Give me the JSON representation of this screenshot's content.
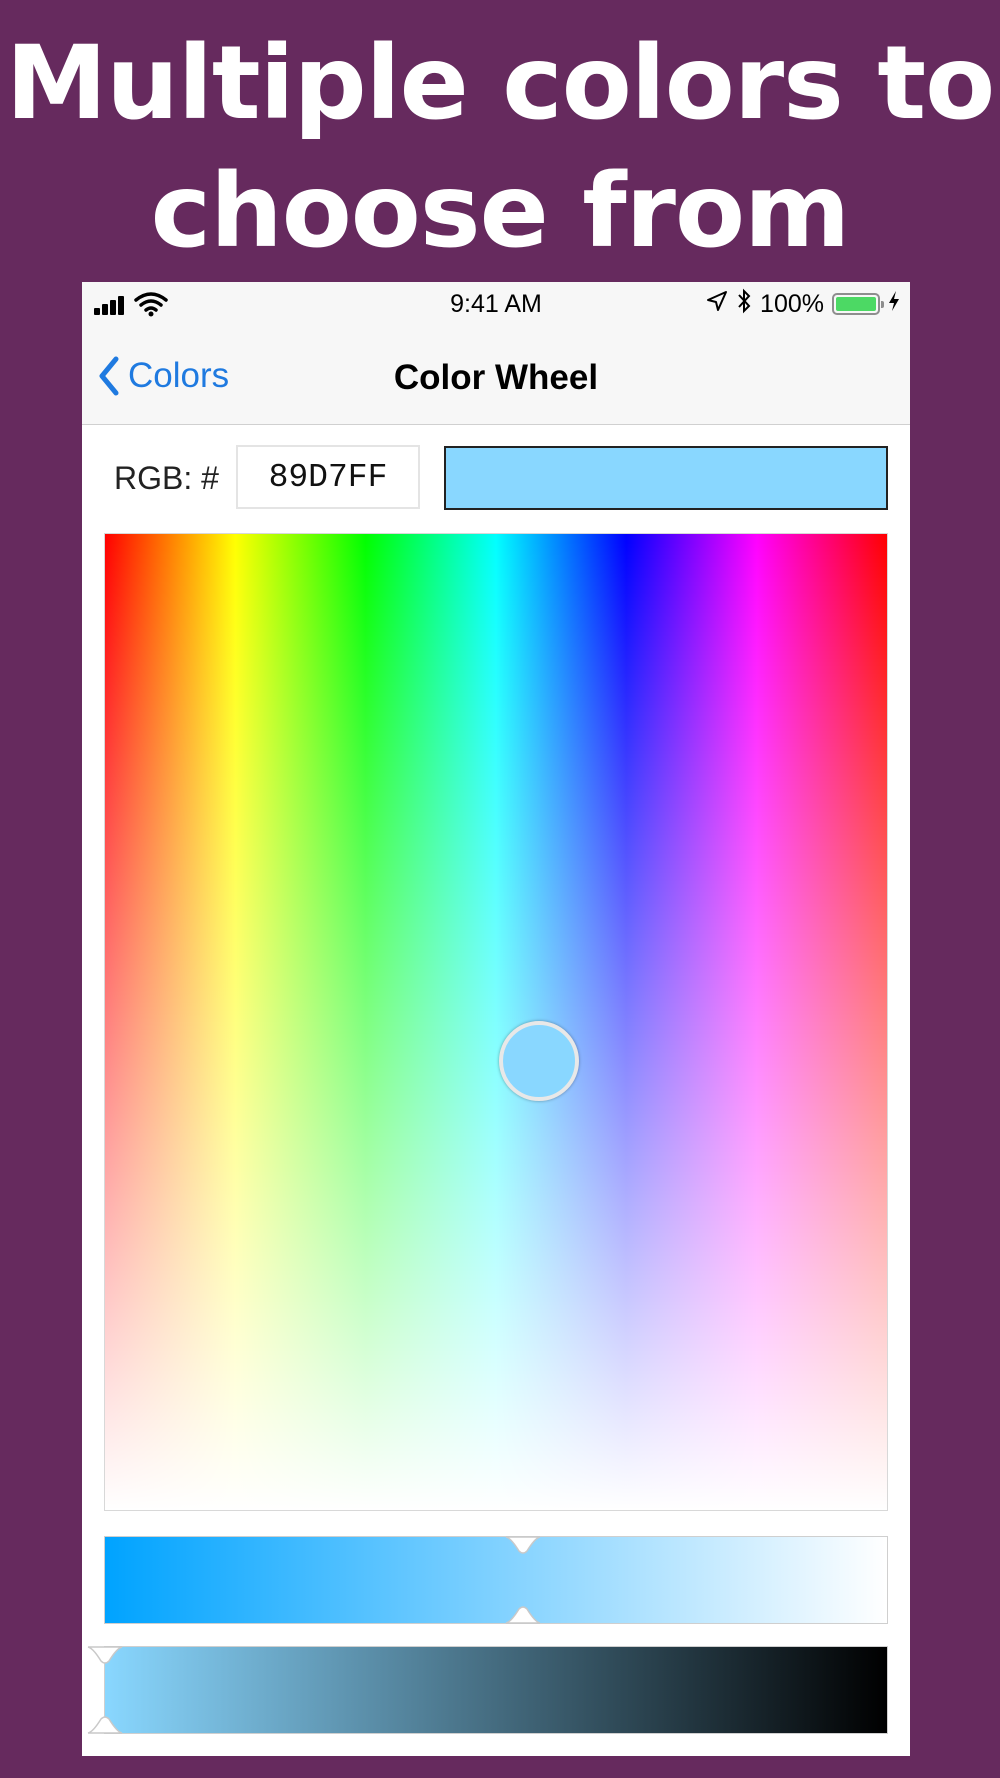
{
  "headline": {
    "line1": "Multiple colors to",
    "line2": "choose from"
  },
  "status_bar": {
    "time": "9:41 AM",
    "battery_percent": "100%",
    "icons": [
      "signal-icon",
      "wifi-icon",
      "location-icon",
      "bluetooth-icon",
      "battery-icon",
      "charging-icon"
    ]
  },
  "nav": {
    "back_label": "Colors",
    "title": "Color Wheel"
  },
  "color": {
    "rgb_label": "RGB: #",
    "hex_value": "89D7FF",
    "swatch_color": "#89d7ff"
  },
  "picker": {
    "hue_fraction": 0.555,
    "whiteness_fraction": 0.54,
    "saturation_slider_fraction": 0.535,
    "brightness_slider_fraction": 0.0
  },
  "colors": {
    "background": "#662a5e",
    "accent": "#1f7ae0",
    "saturation_start": "#00a3ff",
    "saturation_end": "#ffffff",
    "brightness_start": "#89d7ff",
    "brightness_end": "#000000"
  }
}
